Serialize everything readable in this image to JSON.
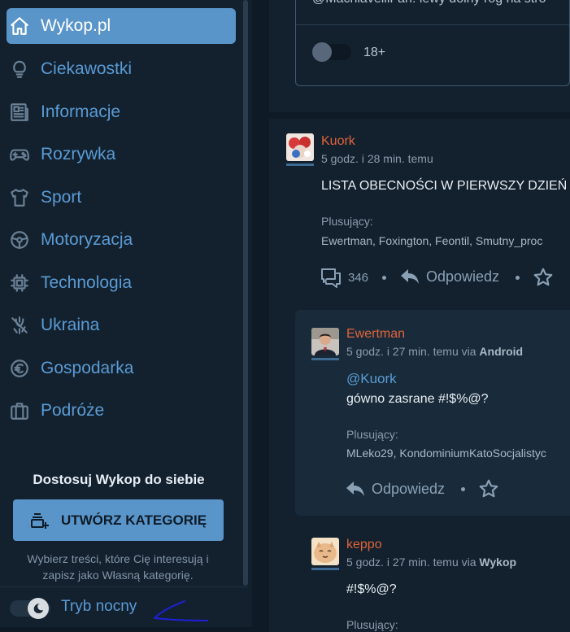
{
  "sidebar": {
    "items": [
      {
        "label": "Wykop.pl",
        "icon": "home-icon",
        "active": true
      },
      {
        "label": "Ciekawostki",
        "icon": "lightbulb-icon"
      },
      {
        "label": "Informacje",
        "icon": "newspaper-icon"
      },
      {
        "label": "Rozrywka",
        "icon": "gamepad-icon"
      },
      {
        "label": "Sport",
        "icon": "tshirt-icon"
      },
      {
        "label": "Motoryzacja",
        "icon": "steering-wheel-icon"
      },
      {
        "label": "Technologia",
        "icon": "chip-icon"
      },
      {
        "label": "Ukraina",
        "icon": "ukraine-icon"
      },
      {
        "label": "Gospodarka",
        "icon": "euro-icon"
      },
      {
        "label": "Podróże",
        "icon": "suitcase-icon"
      }
    ],
    "customize_title": "Dostosuj Wykop do siebie",
    "create_category_label": "UTWÓRZ KATEGORIĘ",
    "category_description": "Wybierz treści, które Cię interesują i zapisz jako Własną kategorię.",
    "night_mode_label": "Tryb nocny"
  },
  "top_entry": {
    "partial_text": "@MachiavelliFan: lewy dolny róg na stro",
    "nsfw_label": "18+"
  },
  "entry": {
    "author": "Kuork",
    "time": "5 godz. i 28 min. temu",
    "text": "LISTA OBECNOŚCI W PIERWSZY DZIEŃ",
    "plus_label": "Plusujący:",
    "plus_list": "Ewertman, Foxington, Feontil, Smutny_proc",
    "comments_count": "346",
    "reply_label": "Odpowiedz"
  },
  "comments": [
    {
      "author": "Ewertman",
      "time": "5 godz. i 27 min. temu via",
      "via": "Android",
      "mention": "@Kuork",
      "text": "gówno zasrane #!$%@?",
      "plus_label": "Plusujący:",
      "plus_list": "MLeko29, KondominiumKatoSocjalistyc",
      "reply_label": "Odpowiedz"
    },
    {
      "author": "keppo",
      "time": "5 godz. i 27 min. temu via",
      "via": "Wykop",
      "text": "#!$%@?",
      "plus_label": "Plusujący:"
    }
  ],
  "colors": {
    "accent": "#5a95c9",
    "author": "#e0643a",
    "background": "#0e1a25",
    "panel": "#13212e"
  }
}
